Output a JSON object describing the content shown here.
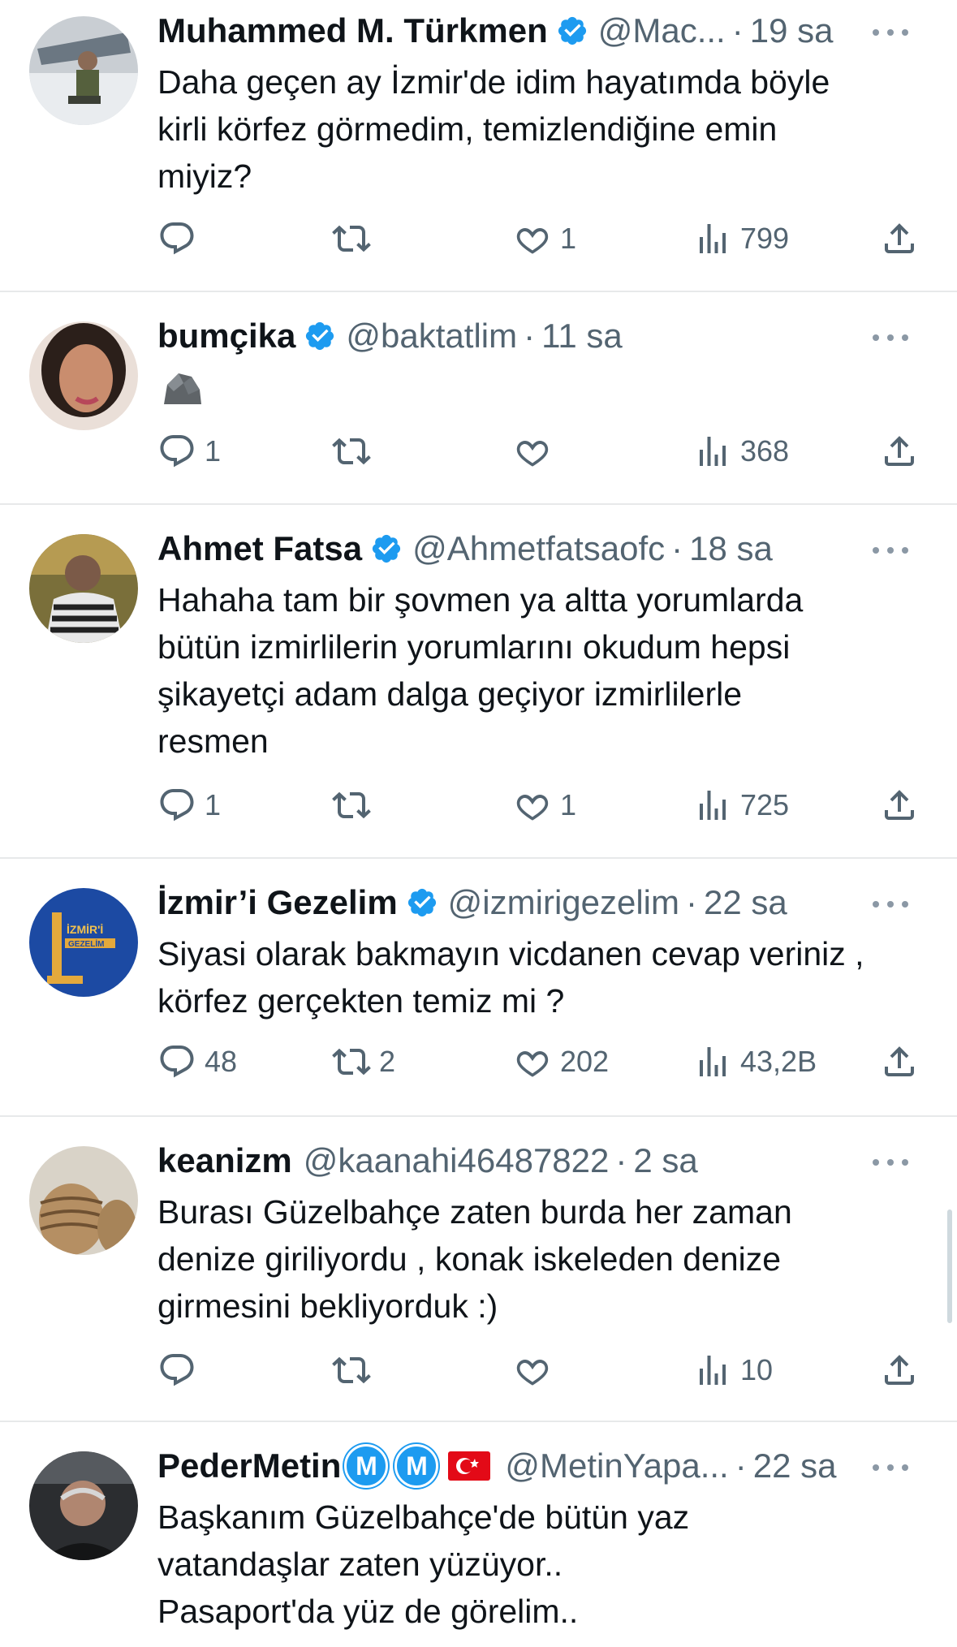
{
  "tweets": [
    {
      "name": "Muhammed M. Türkmen",
      "handle": "@Mac...",
      "time": "19 sa",
      "text": "Daha geçen ay İzmir'de idim hayatımda böyle\nkirli körfez görmedim, temizlendiğine emin\nmiyiz?",
      "replies": "",
      "retweets": "",
      "likes": "1",
      "views": "799"
    },
    {
      "name": "bumçika",
      "handle": "@baktatlim",
      "time": "11 sa",
      "text": "",
      "replies": "1",
      "retweets": "",
      "likes": "",
      "views": "368"
    },
    {
      "name": "Ahmet Fatsa",
      "handle": "@Ahmetfatsaofc",
      "time": "18 sa",
      "text": "Hahaha tam bir şovmen ya altta yorumlarda\nbütün izmirlilerin yorumlarını okudum hepsi\nşikayetçi adam dalga geçiyor izmirlilerle\nresmen",
      "replies": "1",
      "retweets": "",
      "likes": "1",
      "views": "725"
    },
    {
      "name": "İzmir’i Gezelim",
      "handle": "@izmirigezelim",
      "time": "22 sa",
      "text": "Siyasi olarak bakmayın vicdanen cevap veriniz ,\nkörfez gerçekten temiz mi ?",
      "replies": "48",
      "retweets": "2",
      "likes": "202",
      "views": "43,2B",
      "avatar_text_1": "İZMİR'İ",
      "avatar_text_2": "GEZELİM"
    },
    {
      "name": "keanizm",
      "handle": "@kaanahi46487822",
      "time": "2 sa",
      "text": "Burası Güzelbahçe zaten burda her zaman\ndenize giriliyordu , konak iskeleden denize\ngirmesini bekliyorduk :)",
      "replies": "",
      "retweets": "",
      "likes": "",
      "views": "10"
    },
    {
      "name": "PederMetin",
      "badge1": "M",
      "badge2": "M",
      "handle": "@MetinYapa...",
      "time": "22 sa",
      "text": "Başkanım Güzelbahçe'de bütün yaz\nvatandaşlar zaten yüzüyor..\nPasaport'da yüz de görelim.."
    }
  ],
  "separator": "·",
  "colors": {
    "accent": "#1d9bf0",
    "muted": "#536471",
    "divider": "#e7e9ea",
    "flag": "#e30a17"
  },
  "icons": [
    "reply-icon",
    "retweet-icon",
    "like-icon",
    "views-icon",
    "share-icon",
    "verified-icon",
    "more-icon",
    "rock-emoji-icon"
  ]
}
